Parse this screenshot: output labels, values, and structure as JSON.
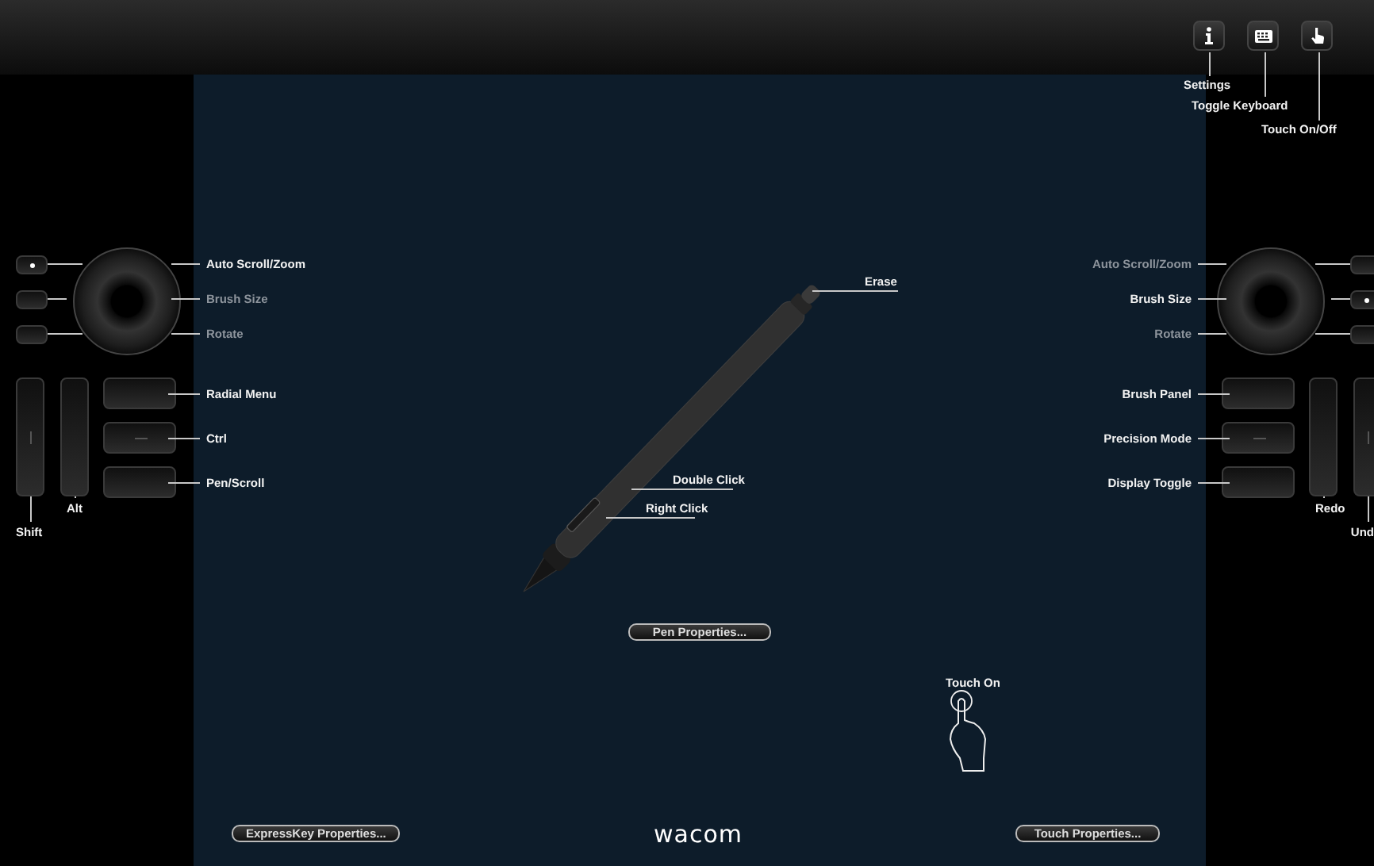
{
  "toolbar": {
    "buttons": [
      {
        "kind": "info",
        "label": "Settings"
      },
      {
        "kind": "keyboard",
        "label": "Toggle Keyboard"
      },
      {
        "kind": "touch",
        "label": "Touch On/Off"
      }
    ]
  },
  "left_panel": {
    "touch_ring": {
      "modes": [
        {
          "label": "Auto Scroll/Zoom",
          "selected": true
        },
        {
          "label": "Brush Size",
          "selected": false
        },
        {
          "label": "Rotate",
          "selected": false
        }
      ]
    },
    "tall_keys": [
      {
        "label": "Shift"
      },
      {
        "label": "Alt"
      }
    ],
    "express_keys": [
      {
        "label": "Radial Menu"
      },
      {
        "label": "Ctrl"
      },
      {
        "label": "Pen/Scroll"
      }
    ]
  },
  "pen": {
    "buttons": [
      {
        "kind": "eraser",
        "label": "Erase"
      },
      {
        "kind": "upper",
        "label": "Double Click"
      },
      {
        "kind": "lower",
        "label": "Right Click"
      }
    ],
    "properties_button": "Pen Properties..."
  },
  "touch": {
    "status": "Touch On",
    "properties_button": "Touch Properties..."
  },
  "expresskey_properties_button": "ExpressKey Properties...",
  "logo": "wacom",
  "right_panel": {
    "touch_ring": {
      "modes": [
        {
          "label": "Auto Scroll/Zoom",
          "selected": false
        },
        {
          "label": "Brush Size",
          "selected": true
        },
        {
          "label": "Rotate",
          "selected": false
        }
      ]
    },
    "tall_keys": [
      {
        "label": "Redo"
      },
      {
        "label": "Und"
      }
    ],
    "express_keys": [
      {
        "label": "Brush Panel"
      },
      {
        "label": "Precision Mode"
      },
      {
        "label": "Display Toggle"
      }
    ]
  }
}
